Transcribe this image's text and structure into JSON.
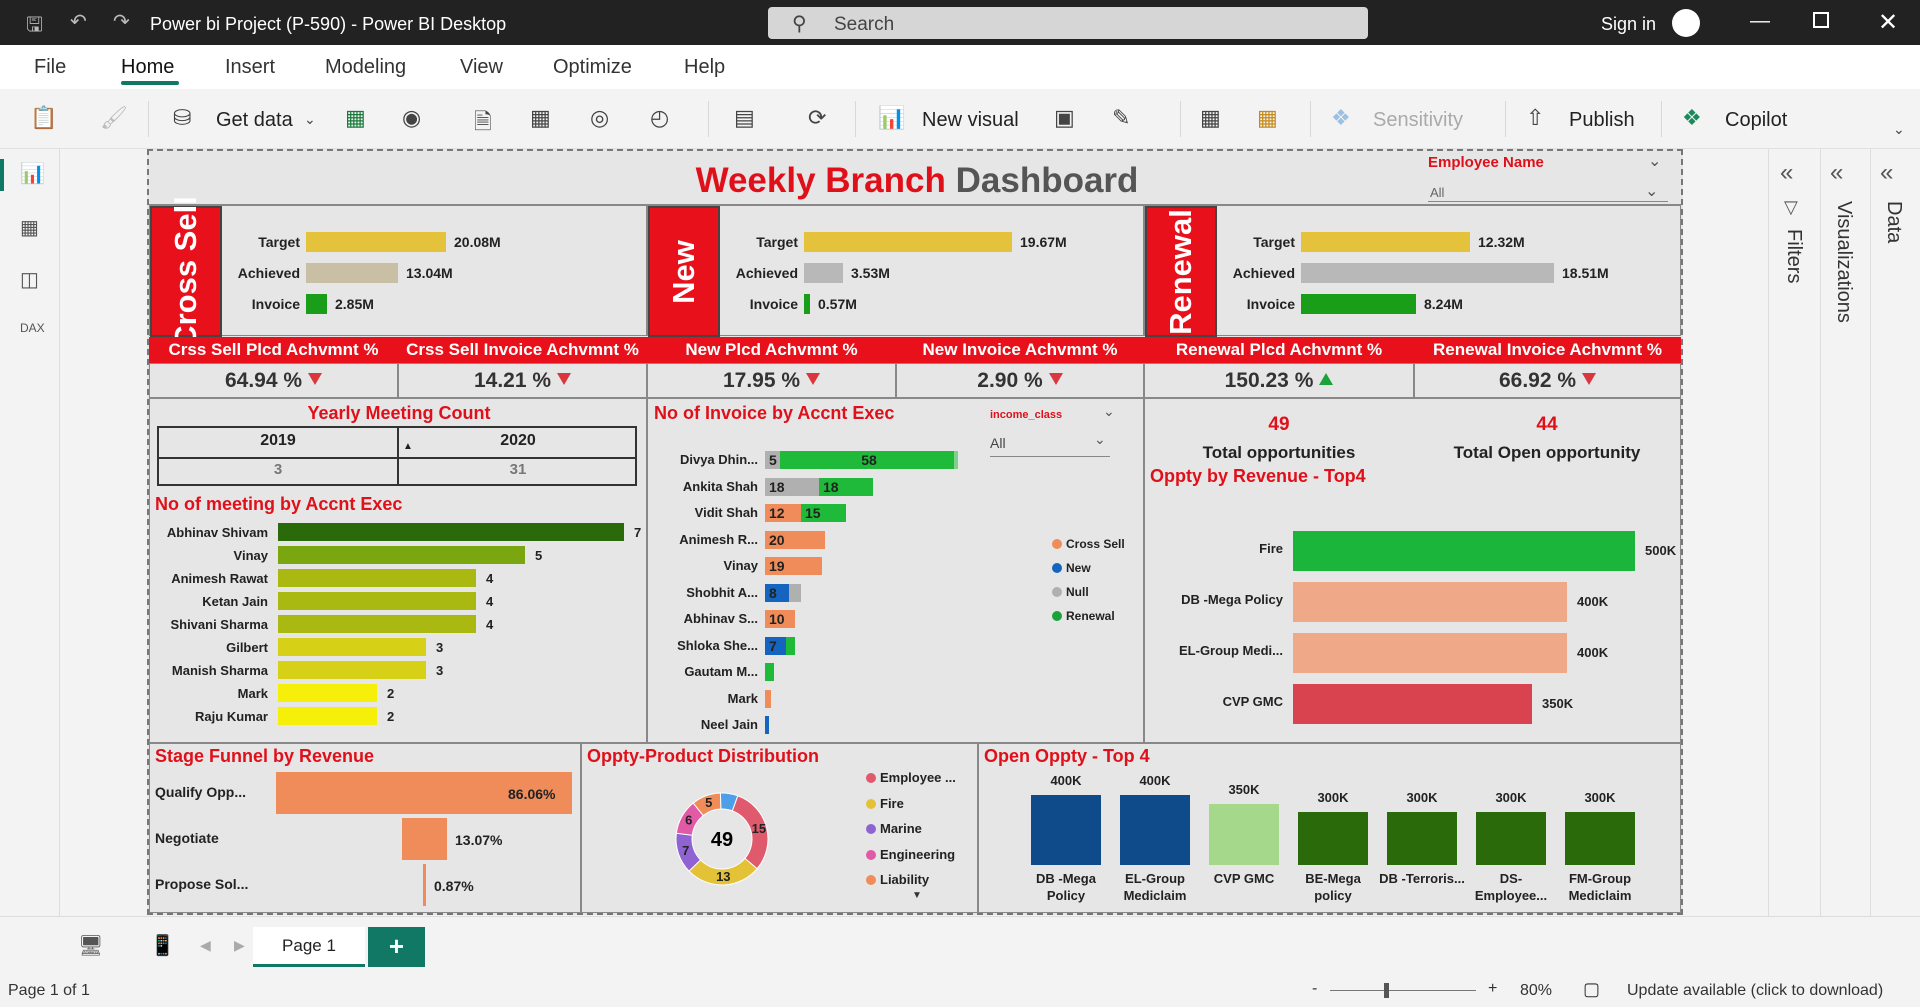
{
  "window": {
    "title": "Power bi Project (P-590) - Power BI Desktop",
    "search_placeholder": "Search",
    "sign_in": "Sign in"
  },
  "menu": [
    "File",
    "Home",
    "Insert",
    "Modeling",
    "View",
    "Optimize",
    "Help"
  ],
  "ribbon": {
    "get_data": "Get data",
    "new_visual": "New visual",
    "sensitivity": "Sensitivity",
    "publish": "Publish",
    "copilot": "Copilot"
  },
  "panes": {
    "filters": "Filters",
    "visualizations": "Visualizations",
    "data": "Data"
  },
  "pagebar": {
    "page_tab": "Page 1",
    "add": "+"
  },
  "status": {
    "page": "Page 1 of 1",
    "zoom": "80%",
    "update": "Update available (click to download)",
    "minus": "-",
    "plus": "+"
  },
  "dashboard": {
    "title_a": "Weekly Branch",
    "title_b": "Dashboard",
    "employee_filter": {
      "label": "Employee Name",
      "value": "All"
    },
    "segments": [
      {
        "label": "Cross Sell",
        "rows": [
          {
            "name": "Target",
            "value": "20.08M",
            "pct": 0.47,
            "color": "#e5c23b"
          },
          {
            "name": "Achieved",
            "value": "13.04M",
            "pct": 0.31,
            "color": "#c8bfa4"
          },
          {
            "name": "Invoice",
            "value": "2.85M",
            "pct": 0.07,
            "color": "#1a9e1a"
          }
        ]
      },
      {
        "label": "New",
        "rows": [
          {
            "name": "Target",
            "value": "19.67M",
            "pct": 0.7,
            "color": "#e5c23b"
          },
          {
            "name": "Achieved",
            "value": "3.53M",
            "pct": 0.13,
            "color": "#b8b8b8"
          },
          {
            "name": "Invoice",
            "value": "0.57M",
            "pct": 0.02,
            "color": "#1a9e1a"
          }
        ]
      },
      {
        "label": "Renewal",
        "rows": [
          {
            "name": "Target",
            "value": "12.32M",
            "pct": 0.5,
            "color": "#e5c23b"
          },
          {
            "name": "Achieved",
            "value": "18.51M",
            "pct": 0.75,
            "color": "#b8b8b8"
          },
          {
            "name": "Invoice",
            "value": "8.24M",
            "pct": 0.34,
            "color": "#1a9e1a"
          }
        ]
      }
    ],
    "kpis": [
      {
        "label": "Crss Sell Plcd Achvmnt %",
        "value": "64.94 %",
        "trend": "down"
      },
      {
        "label": "Crss Sell Invoice Achvmnt %",
        "value": "14.21 %",
        "trend": "down"
      },
      {
        "label": "New Plcd Achvmnt %",
        "value": "17.95 %",
        "trend": "down"
      },
      {
        "label": "New Invoice Achvmnt %",
        "value": "2.90 %",
        "trend": "down"
      },
      {
        "label": "Renewal Plcd Achvmnt %",
        "value": "150.23 %",
        "trend": "up"
      },
      {
        "label": "Renewal Invoice Achvmnt %",
        "value": "66.92 %",
        "trend": "down"
      }
    ],
    "yearly_meeting": {
      "title": "Yearly Meeting Count",
      "years": [
        "2019",
        "2020"
      ],
      "counts": [
        "3",
        "31"
      ]
    },
    "meetings_by_exec": {
      "title": "No of meeting by Accnt Exec",
      "rows": [
        {
          "name": "Abhinav Shivam",
          "value": 7,
          "color": "#2a6a0a"
        },
        {
          "name": "Vinay",
          "value": 5,
          "color": "#7aa60f"
        },
        {
          "name": "Animesh Rawat",
          "value": 4,
          "color": "#aab812"
        },
        {
          "name": "Ketan Jain",
          "value": 4,
          "color": "#aab812"
        },
        {
          "name": "Shivani Sharma",
          "value": 4,
          "color": "#aab812"
        },
        {
          "name": "Gilbert",
          "value": 3,
          "color": "#d6d116"
        },
        {
          "name": "Manish Sharma",
          "value": 3,
          "color": "#d6d116"
        },
        {
          "name": "Mark",
          "value": 2,
          "color": "#f5ef0a"
        },
        {
          "name": "Raju Kumar",
          "value": 2,
          "color": "#f5ef0a"
        }
      ]
    },
    "invoice_by_exec": {
      "title": "No of Invoice by Accnt Exec",
      "slicer_label": "income_class",
      "slicer_value": "All",
      "legend": [
        {
          "name": "Cross Sell",
          "color": "#ef8c5a"
        },
        {
          "name": "New",
          "color": "#1565c0"
        },
        {
          "name": "Null",
          "color": "#b0b0b0"
        },
        {
          "name": "Renewal",
          "color": "#1aa33a"
        }
      ],
      "rows": [
        {
          "name": "Divya Dhin...",
          "segs": [
            {
              "v": 5,
              "c": "#b0b0b0"
            },
            {
              "v": 58,
              "c": "#1fba3a"
            },
            {
              "v": 1,
              "c": "#7fd08a"
            }
          ]
        },
        {
          "name": "Ankita Shah",
          "segs": [
            {
              "v": 18,
              "c": "#b0b0b0"
            },
            {
              "v": 18,
              "c": "#1fba3a"
            }
          ]
        },
        {
          "name": "Vidit Shah",
          "segs": [
            {
              "v": 12,
              "c": "#ef8c5a"
            },
            {
              "v": 15,
              "c": "#1fba3a"
            }
          ]
        },
        {
          "name": "Animesh R...",
          "segs": [
            {
              "v": 20,
              "c": "#ef8c5a"
            }
          ]
        },
        {
          "name": "Vinay",
          "segs": [
            {
              "v": 19,
              "c": "#ef8c5a"
            }
          ]
        },
        {
          "name": "Shobhit A...",
          "segs": [
            {
              "v": 8,
              "c": "#1565c0"
            },
            {
              "v": 4,
              "c": "#b0b0b0"
            }
          ]
        },
        {
          "name": "Abhinav S...",
          "segs": [
            {
              "v": 10,
              "c": "#ef8c5a"
            }
          ]
        },
        {
          "name": "Shloka She...",
          "segs": [
            {
              "v": 7,
              "c": "#1565c0"
            },
            {
              "v": 3,
              "c": "#1fba3a"
            }
          ]
        },
        {
          "name": "Gautam M...",
          "segs": [
            {
              "v": 3,
              "c": "#1fba3a"
            }
          ]
        },
        {
          "name": "Mark",
          "segs": [
            {
              "v": 2,
              "c": "#ef8c5a",
              "hide": true
            }
          ]
        },
        {
          "name": "Neel Jain",
          "segs": [
            {
              "v": 1,
              "c": "#1565c0",
              "hide": true
            }
          ]
        }
      ]
    },
    "opportunities": {
      "total": "49",
      "total_label": "Total opportunities",
      "open": "44",
      "open_label": "Total Open opportunity"
    },
    "oppty_revenue": {
      "title": "Oppty by Revenue - Top4",
      "rows": [
        {
          "name": "Fire",
          "value": 500,
          "label": "500K",
          "color": "#1ab53a"
        },
        {
          "name": "DB -Mega Policy",
          "value": 400,
          "label": "400K",
          "color": "#efa888"
        },
        {
          "name": "EL-Group Medi...",
          "value": 400,
          "label": "400K",
          "color": "#efa888"
        },
        {
          "name": "CVP GMC",
          "value": 350,
          "label": "350K",
          "color": "#d9434f"
        }
      ]
    },
    "stage_funnel": {
      "title": "Stage Funnel by Revenue",
      "rows": [
        {
          "name": "Qualify Opp...",
          "value": 86.06,
          "label": "86.06%"
        },
        {
          "name": "Negotiate",
          "value": 13.07,
          "label": "13.07%"
        },
        {
          "name": "Propose Sol...",
          "value": 0.87,
          "label": "0.87%"
        }
      ]
    },
    "product_dist": {
      "title": "Oppty-Product Distribution",
      "center": "49",
      "slices": [
        {
          "v": 15,
          "c": "#e05a6e"
        },
        {
          "v": 13,
          "c": "#e3c238"
        },
        {
          "v": 7,
          "c": "#8f63d1"
        },
        {
          "v": 6,
          "c": "#e05aa6"
        },
        {
          "v": 5,
          "c": "#f08c5a"
        },
        {
          "v": 3,
          "c": "#4f9ee8"
        }
      ],
      "labels": [
        "15",
        "13",
        "7",
        "6",
        "5"
      ],
      "legend": [
        {
          "name": "Employee ...",
          "color": "#e05a6e"
        },
        {
          "name": "Fire",
          "color": "#e3c238"
        },
        {
          "name": "Marine",
          "color": "#8f63d1"
        },
        {
          "name": "Engineering",
          "color": "#e05aa6"
        },
        {
          "name": "Liability",
          "color": "#f08c5a"
        }
      ]
    },
    "open_oppty": {
      "title": "Open Oppty - Top 4",
      "rows": [
        {
          "name": "DB -Mega Policy",
          "value": 400,
          "label": "400K",
          "color": "#0f4a8a"
        },
        {
          "name": "EL-Group Mediclaim",
          "value": 400,
          "label": "400K",
          "color": "#0f4a8a"
        },
        {
          "name": "CVP GMC",
          "value": 350,
          "label": "350K",
          "color": "#a6d88c"
        },
        {
          "name": "BE-Mega policy",
          "value": 300,
          "label": "300K",
          "color": "#2a6a0a"
        },
        {
          "name": "DB -Terroris...",
          "value": 300,
          "label": "300K",
          "color": "#2a6a0a"
        },
        {
          "name": "DS-Employee...",
          "value": 300,
          "label": "300K",
          "color": "#2a6a0a"
        },
        {
          "name": "FM-Group Mediclaim",
          "value": 300,
          "label": "300K",
          "color": "#2a6a0a"
        }
      ]
    }
  },
  "chart_data": [
    {
      "type": "bar",
      "title": "No of meeting by Accnt Exec",
      "categories": [
        "Abhinav Shivam",
        "Vinay",
        "Animesh Rawat",
        "Ketan Jain",
        "Shivani Sharma",
        "Gilbert",
        "Manish Sharma",
        "Mark",
        "Raju Kumar"
      ],
      "values": [
        7,
        5,
        4,
        4,
        4,
        3,
        3,
        2,
        2
      ]
    },
    {
      "type": "bar",
      "title": "No of Invoice by Accnt Exec",
      "categories": [
        "Divya Dhin...",
        "Ankita Shah",
        "Vidit Shah",
        "Animesh R...",
        "Vinay",
        "Shobhit A...",
        "Abhinav S...",
        "Shloka She...",
        "Gautam M...",
        "Mark",
        "Neel Jain"
      ],
      "series": [
        {
          "name": "Cross Sell",
          "values": [
            0,
            0,
            12,
            20,
            19,
            0,
            10,
            0,
            0,
            2,
            0
          ]
        },
        {
          "name": "New",
          "values": [
            0,
            0,
            0,
            0,
            0,
            8,
            0,
            7,
            0,
            0,
            1
          ]
        },
        {
          "name": "Null",
          "values": [
            5,
            18,
            0,
            0,
            0,
            4,
            0,
            0,
            0,
            0,
            0
          ]
        },
        {
          "name": "Renewal",
          "values": [
            58,
            18,
            15,
            0,
            0,
            0,
            0,
            3,
            3,
            0,
            0
          ]
        }
      ]
    },
    {
      "type": "bar",
      "title": "Oppty by Revenue - Top4",
      "categories": [
        "Fire",
        "DB -Mega Policy",
        "EL-Group Medi...",
        "CVP GMC"
      ],
      "values": [
        500,
        400,
        400,
        350
      ]
    },
    {
      "type": "bar",
      "title": "Stage Funnel by Revenue",
      "categories": [
        "Qualify Opp...",
        "Negotiate",
        "Propose Sol..."
      ],
      "values": [
        86.06,
        13.07,
        0.87
      ]
    },
    {
      "type": "pie",
      "title": "Oppty-Product Distribution",
      "categories": [
        "Employee ...",
        "Fire",
        "Marine",
        "Engineering",
        "Liability"
      ],
      "values": [
        15,
        13,
        7,
        6,
        5
      ]
    },
    {
      "type": "bar",
      "title": "Open Oppty - Top 4",
      "categories": [
        "DB -Mega Policy",
        "EL-Group Mediclaim",
        "CVP GMC",
        "BE-Mega policy",
        "DB -Terroris...",
        "DS-Employee...",
        "FM-Group Mediclaim"
      ],
      "values": [
        400,
        400,
        350,
        300,
        300,
        300,
        300
      ]
    }
  ]
}
